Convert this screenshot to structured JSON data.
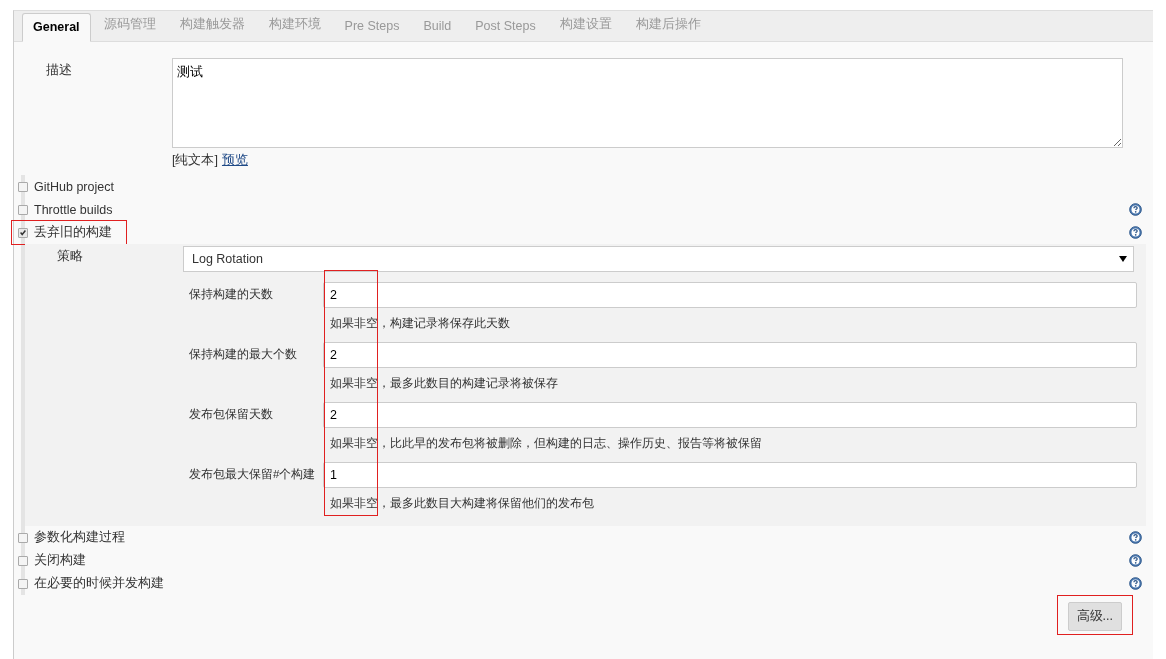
{
  "tabs": [
    {
      "label": "General",
      "selected": true
    },
    {
      "label": "源码管理",
      "selected": false
    },
    {
      "label": "构建触发器",
      "selected": false
    },
    {
      "label": "构建环境",
      "selected": false
    },
    {
      "label": "Pre Steps",
      "selected": false
    },
    {
      "label": "Build",
      "selected": false
    },
    {
      "label": "Post Steps",
      "selected": false
    },
    {
      "label": "构建设置",
      "selected": false
    },
    {
      "label": "构建后操作",
      "selected": false
    }
  ],
  "description": {
    "label": "描述",
    "value": "测试",
    "format_note": "[纯文本]",
    "preview_link": "预览"
  },
  "options": [
    {
      "label": "GitHub project",
      "checked": false,
      "help": false,
      "highlighted": false
    },
    {
      "label": "Throttle builds",
      "checked": false,
      "help": true,
      "highlighted": false
    },
    {
      "label": "丢弃旧的构建",
      "checked": true,
      "help": true,
      "highlighted": true,
      "strategy": {
        "label": "策略",
        "value": "Log Rotation",
        "highlight_inputs": true,
        "fields": [
          {
            "label": "保持构建的天数",
            "value": "2",
            "hint": "如果非空，构建记录将保存此天数"
          },
          {
            "label": "保持构建的最大个数",
            "value": "2",
            "hint": "如果非空，最多此数目的构建记录将被保存"
          },
          {
            "label": "发布包保留天数",
            "value": "2",
            "hint": "如果非空，比此早的发布包将被删除，但构建的日志、操作历史、报告等将被保留"
          },
          {
            "label": "发布包最大保留#个构建",
            "value": "1",
            "hint": "如果非空，最多此数目大构建将保留他们的发布包"
          }
        ]
      }
    },
    {
      "label": "参数化构建过程",
      "checked": false,
      "help": true,
      "highlighted": false
    },
    {
      "label": "关闭构建",
      "checked": false,
      "help": true,
      "highlighted": false
    },
    {
      "label": "在必要的时候并发构建",
      "checked": false,
      "help": true,
      "highlighted": false
    }
  ],
  "advanced_button": {
    "label": "高级...",
    "highlighted": true
  }
}
